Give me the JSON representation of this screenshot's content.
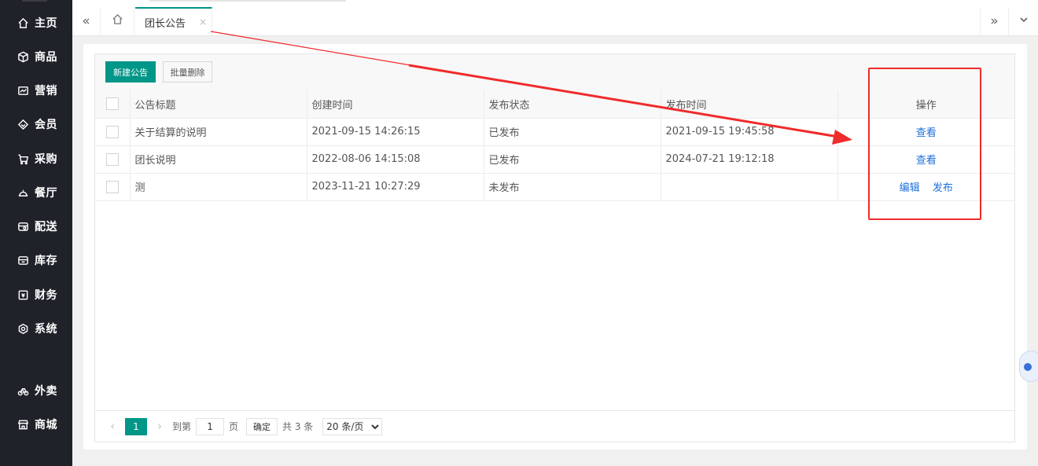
{
  "sidebar": {
    "items": [
      {
        "label": "主页",
        "icon": "home-icon"
      },
      {
        "label": "商品",
        "icon": "box-icon"
      },
      {
        "label": "营销",
        "icon": "chart-icon"
      },
      {
        "label": "会员",
        "icon": "diamond-icon"
      },
      {
        "label": "采购",
        "icon": "cart-icon"
      },
      {
        "label": "餐厅",
        "icon": "dish-icon"
      },
      {
        "label": "配送",
        "icon": "delivery-icon"
      },
      {
        "label": "库存",
        "icon": "inventory-icon"
      },
      {
        "label": "财务",
        "icon": "finance-icon"
      },
      {
        "label": "系统",
        "icon": "settings-icon"
      },
      {
        "label": "外卖",
        "icon": "bike-icon"
      },
      {
        "label": "商城",
        "icon": "store-icon"
      }
    ]
  },
  "tabs": {
    "active": {
      "label": "团长公告",
      "close": "×"
    },
    "collapse_left": "«",
    "expand_right": "»"
  },
  "toolbar": {
    "new_label": "新建公告",
    "batch_delete_label": "批量删除"
  },
  "table": {
    "columns": [
      "公告标题",
      "创建时间",
      "发布状态",
      "发布时间",
      "操作"
    ],
    "rows": [
      {
        "title": "关于结算的说明",
        "created": "2021-09-15 14:26:15",
        "status": "已发布",
        "published": "2021-09-15 19:45:58",
        "actions": [
          "查看"
        ]
      },
      {
        "title": "团长说明",
        "created": "2022-08-06 14:15:08",
        "status": "已发布",
        "published": "2024-07-21 19:12:18",
        "actions": [
          "查看"
        ]
      },
      {
        "title": "测",
        "created": "2023-11-21 10:27:29",
        "status": "未发布",
        "published": "",
        "actions": [
          "编辑",
          "发布"
        ]
      }
    ]
  },
  "pager": {
    "current": "1",
    "goto_prefix": "到第",
    "goto_value": "1",
    "goto_suffix": "页",
    "confirm": "确定",
    "total": "共 3 条",
    "page_size": "20 条/页"
  },
  "colors": {
    "sidebar_bg": "#20222a",
    "accent": "#009688",
    "link": "#1e6fd9",
    "annotation": "#ef2b2b"
  }
}
